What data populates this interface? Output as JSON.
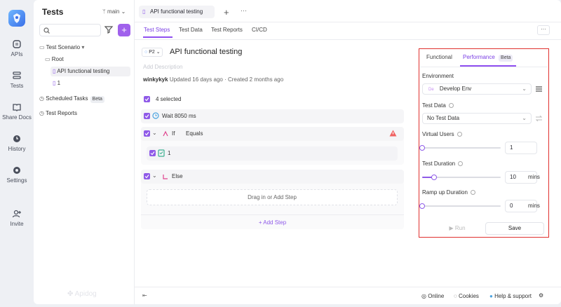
{
  "rail": {
    "items": [
      {
        "label": "APIs"
      },
      {
        "label": "Tests"
      },
      {
        "label": "Share Docs"
      },
      {
        "label": "History"
      },
      {
        "label": "Settings"
      },
      {
        "label": "Invite"
      }
    ]
  },
  "tree": {
    "title": "Tests",
    "branch": "main",
    "plus": "+",
    "scenario_label": "Test Scenario",
    "root_label": "Root",
    "items": [
      "API functional testing",
      "1"
    ],
    "scheduled_label": "Scheduled Tasks",
    "scheduled_badge": "Beta",
    "reports_label": "Test Reports",
    "watermark": "Apidog"
  },
  "editor": {
    "file_tab": "API functional testing",
    "new_tab": "+",
    "more": "···",
    "subtabs": [
      "Test Steps",
      "Test Data",
      "Test Reports",
      "CI/CD"
    ],
    "priority": "P2",
    "title": "API functional testing",
    "description_placeholder": "Add Description",
    "author": "winkykyk",
    "meta": "Updated 16 days ago · Created 2 months ago",
    "selected": "4 selected",
    "steps": {
      "wait": "Wait 8050 ms",
      "if": "If",
      "if_op": "Equals",
      "child": "1",
      "else": "Else",
      "drag_text": "Drag in or",
      "drag_link": "Add Step",
      "add_step": "+ Add Step"
    }
  },
  "perf": {
    "tabs": [
      "Functional",
      "Performance"
    ],
    "tab_badge": "Beta",
    "environment_label": "Environment",
    "environment_value": "Develop Env",
    "environment_prefix": "De",
    "test_data_label": "Test Data",
    "test_data_value": "No Test Data",
    "virtual_users_label": "Virtual Users",
    "virtual_users_value": "1",
    "virtual_users_level": 0,
    "duration_label": "Test Duration",
    "duration_value": "10",
    "duration_unit": "mins",
    "duration_level": 0.15,
    "ramp_label": "Ramp up Duration",
    "ramp_value": "0",
    "ramp_unit": "mins",
    "ramp_level": 0,
    "run_label": "Run",
    "save_label": "Save"
  },
  "status_bar": {
    "online": "Online",
    "cookies": "Cookies",
    "help": "Help & support"
  },
  "colors": {
    "accent": "#8f5ae8",
    "highlight": "#e0312f",
    "warning": "#f06262"
  }
}
